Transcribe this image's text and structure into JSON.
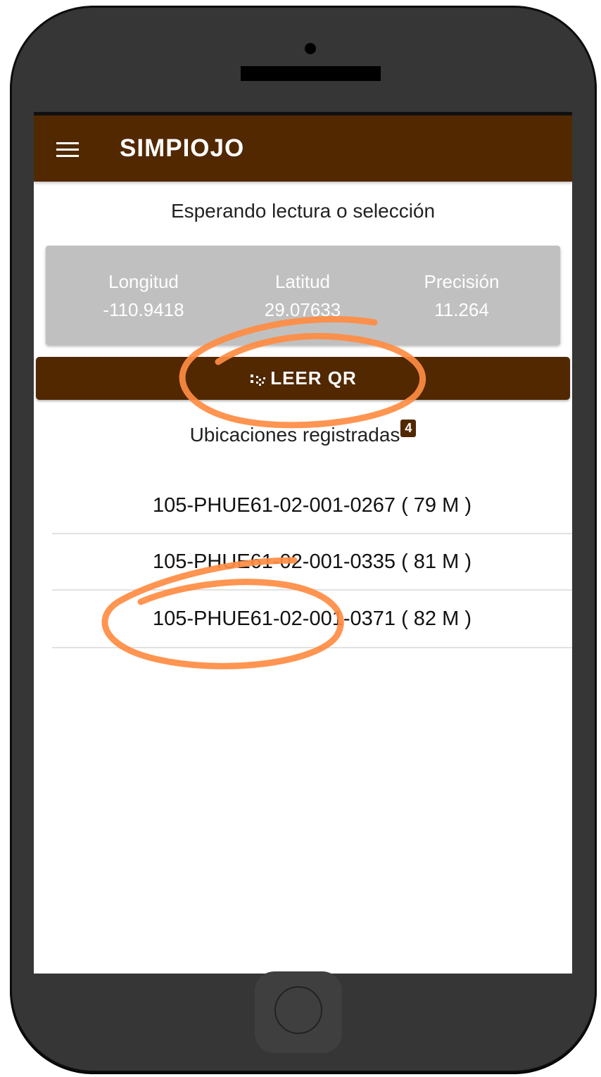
{
  "app": {
    "title": "SIMPIOJO"
  },
  "status": {
    "text": "Esperando lectura o selección"
  },
  "coords": {
    "longitude": {
      "label": "Longitud",
      "value": "-110.9418"
    },
    "latitude": {
      "label": "Latitud",
      "value": "29.07633"
    },
    "precision": {
      "label": "Precisión",
      "value": "11.264"
    }
  },
  "qr_button": {
    "label": "LEER QR",
    "icon": "qr-code-icon"
  },
  "locations": {
    "header": "Ubicaciones registradas",
    "count": "4",
    "items": [
      {
        "label": "105-PHUE61-02-001-0267 ( 79 M )"
      },
      {
        "label": "105-PHUE61-02-001-0335 ( 81 M )"
      },
      {
        "label": "105-PHUE61-02-001-0371 ( 82 M )"
      }
    ]
  },
  "colors": {
    "primary": "#512800",
    "card": "#c0c0c0",
    "annotation": "#ff8c42",
    "phone_body": "#363636"
  }
}
